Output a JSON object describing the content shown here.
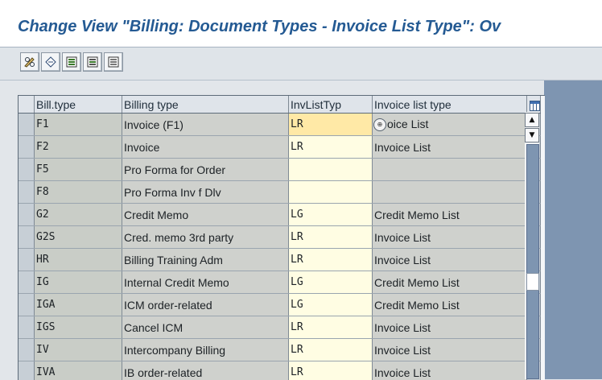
{
  "window": {
    "title": "Change View \"Billing: Document Types - Invoice List Type\": Ov"
  },
  "toolbar": {
    "buttons": [
      {
        "name": "display-change-button",
        "icon": "pencil-glasses-icon"
      },
      {
        "name": "other-entry-button",
        "icon": "swap-icon"
      },
      {
        "name": "select-all-button",
        "icon": "select-all-icon"
      },
      {
        "name": "select-block-button",
        "icon": "select-block-icon"
      },
      {
        "name": "deselect-all-button",
        "icon": "deselect-all-icon"
      }
    ]
  },
  "table": {
    "columns": {
      "billtype": "Bill.type",
      "billing_type": "Billing type",
      "invlisttyp": "InvListTyp",
      "invoice_list_type": "Invoice list type"
    },
    "rows": [
      {
        "billtype": "F1",
        "billing_type": "Invoice (F1)",
        "invlisttyp": "LR",
        "invoice_list_type": "oice List"
      },
      {
        "billtype": "F2",
        "billing_type": "Invoice",
        "invlisttyp": "LR",
        "invoice_list_type": "Invoice List"
      },
      {
        "billtype": "F5",
        "billing_type": "Pro Forma for Order",
        "invlisttyp": "",
        "invoice_list_type": ""
      },
      {
        "billtype": "F8",
        "billing_type": "Pro Forma Inv f Dlv",
        "invlisttyp": "",
        "invoice_list_type": ""
      },
      {
        "billtype": "G2",
        "billing_type": "Credit Memo",
        "invlisttyp": "LG",
        "invoice_list_type": "Credit Memo List"
      },
      {
        "billtype": "G2S",
        "billing_type": "Cred. memo 3rd party",
        "invlisttyp": "LR",
        "invoice_list_type": "Invoice List"
      },
      {
        "billtype": "HR",
        "billing_type": "Billing Training Adm",
        "invlisttyp": "LR",
        "invoice_list_type": "Invoice List"
      },
      {
        "billtype": "IG",
        "billing_type": "Internal Credit Memo",
        "invlisttyp": "LG",
        "invoice_list_type": "Credit Memo List"
      },
      {
        "billtype": "IGA",
        "billing_type": "ICM order-related",
        "invlisttyp": "LG",
        "invoice_list_type": "Credit Memo List"
      },
      {
        "billtype": "IGS",
        "billing_type": "Cancel ICM",
        "invlisttyp": "LR",
        "invoice_list_type": "Invoice List"
      },
      {
        "billtype": "IV",
        "billing_type": "Intercompany Billing",
        "invlisttyp": "LR",
        "invoice_list_type": "Invoice List"
      },
      {
        "billtype": "IVA",
        "billing_type": "IB order-related",
        "invlisttyp": "LR",
        "invoice_list_type": "Invoice List"
      }
    ]
  },
  "scrollbar": {
    "up_glyph": "▲",
    "down_glyph": "▼"
  },
  "cursor": {
    "glyph": "⊕",
    "icon": "cursor-hand-icon"
  },
  "colors": {
    "title": "#245a93",
    "right_panel": "#7e95b1",
    "input_focus": "#ffe9a6"
  }
}
